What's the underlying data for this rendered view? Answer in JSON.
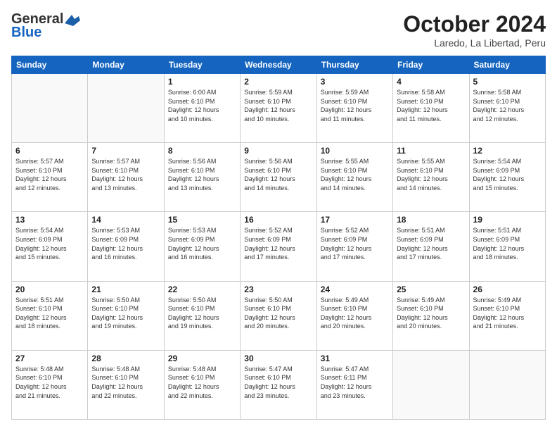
{
  "header": {
    "logo_general": "General",
    "logo_blue": "Blue",
    "month_title": "October 2024",
    "location": "Laredo, La Libertad, Peru"
  },
  "days_of_week": [
    "Sunday",
    "Monday",
    "Tuesday",
    "Wednesday",
    "Thursday",
    "Friday",
    "Saturday"
  ],
  "weeks": [
    [
      {
        "day": "",
        "info": ""
      },
      {
        "day": "",
        "info": ""
      },
      {
        "day": "1",
        "info": "Sunrise: 6:00 AM\nSunset: 6:10 PM\nDaylight: 12 hours\nand 10 minutes."
      },
      {
        "day": "2",
        "info": "Sunrise: 5:59 AM\nSunset: 6:10 PM\nDaylight: 12 hours\nand 10 minutes."
      },
      {
        "day": "3",
        "info": "Sunrise: 5:59 AM\nSunset: 6:10 PM\nDaylight: 12 hours\nand 11 minutes."
      },
      {
        "day": "4",
        "info": "Sunrise: 5:58 AM\nSunset: 6:10 PM\nDaylight: 12 hours\nand 11 minutes."
      },
      {
        "day": "5",
        "info": "Sunrise: 5:58 AM\nSunset: 6:10 PM\nDaylight: 12 hours\nand 12 minutes."
      }
    ],
    [
      {
        "day": "6",
        "info": "Sunrise: 5:57 AM\nSunset: 6:10 PM\nDaylight: 12 hours\nand 12 minutes."
      },
      {
        "day": "7",
        "info": "Sunrise: 5:57 AM\nSunset: 6:10 PM\nDaylight: 12 hours\nand 13 minutes."
      },
      {
        "day": "8",
        "info": "Sunrise: 5:56 AM\nSunset: 6:10 PM\nDaylight: 12 hours\nand 13 minutes."
      },
      {
        "day": "9",
        "info": "Sunrise: 5:56 AM\nSunset: 6:10 PM\nDaylight: 12 hours\nand 14 minutes."
      },
      {
        "day": "10",
        "info": "Sunrise: 5:55 AM\nSunset: 6:10 PM\nDaylight: 12 hours\nand 14 minutes."
      },
      {
        "day": "11",
        "info": "Sunrise: 5:55 AM\nSunset: 6:10 PM\nDaylight: 12 hours\nand 14 minutes."
      },
      {
        "day": "12",
        "info": "Sunrise: 5:54 AM\nSunset: 6:09 PM\nDaylight: 12 hours\nand 15 minutes."
      }
    ],
    [
      {
        "day": "13",
        "info": "Sunrise: 5:54 AM\nSunset: 6:09 PM\nDaylight: 12 hours\nand 15 minutes."
      },
      {
        "day": "14",
        "info": "Sunrise: 5:53 AM\nSunset: 6:09 PM\nDaylight: 12 hours\nand 16 minutes."
      },
      {
        "day": "15",
        "info": "Sunrise: 5:53 AM\nSunset: 6:09 PM\nDaylight: 12 hours\nand 16 minutes."
      },
      {
        "day": "16",
        "info": "Sunrise: 5:52 AM\nSunset: 6:09 PM\nDaylight: 12 hours\nand 17 minutes."
      },
      {
        "day": "17",
        "info": "Sunrise: 5:52 AM\nSunset: 6:09 PM\nDaylight: 12 hours\nand 17 minutes."
      },
      {
        "day": "18",
        "info": "Sunrise: 5:51 AM\nSunset: 6:09 PM\nDaylight: 12 hours\nand 17 minutes."
      },
      {
        "day": "19",
        "info": "Sunrise: 5:51 AM\nSunset: 6:09 PM\nDaylight: 12 hours\nand 18 minutes."
      }
    ],
    [
      {
        "day": "20",
        "info": "Sunrise: 5:51 AM\nSunset: 6:10 PM\nDaylight: 12 hours\nand 18 minutes."
      },
      {
        "day": "21",
        "info": "Sunrise: 5:50 AM\nSunset: 6:10 PM\nDaylight: 12 hours\nand 19 minutes."
      },
      {
        "day": "22",
        "info": "Sunrise: 5:50 AM\nSunset: 6:10 PM\nDaylight: 12 hours\nand 19 minutes."
      },
      {
        "day": "23",
        "info": "Sunrise: 5:50 AM\nSunset: 6:10 PM\nDaylight: 12 hours\nand 20 minutes."
      },
      {
        "day": "24",
        "info": "Sunrise: 5:49 AM\nSunset: 6:10 PM\nDaylight: 12 hours\nand 20 minutes."
      },
      {
        "day": "25",
        "info": "Sunrise: 5:49 AM\nSunset: 6:10 PM\nDaylight: 12 hours\nand 20 minutes."
      },
      {
        "day": "26",
        "info": "Sunrise: 5:49 AM\nSunset: 6:10 PM\nDaylight: 12 hours\nand 21 minutes."
      }
    ],
    [
      {
        "day": "27",
        "info": "Sunrise: 5:48 AM\nSunset: 6:10 PM\nDaylight: 12 hours\nand 21 minutes."
      },
      {
        "day": "28",
        "info": "Sunrise: 5:48 AM\nSunset: 6:10 PM\nDaylight: 12 hours\nand 22 minutes."
      },
      {
        "day": "29",
        "info": "Sunrise: 5:48 AM\nSunset: 6:10 PM\nDaylight: 12 hours\nand 22 minutes."
      },
      {
        "day": "30",
        "info": "Sunrise: 5:47 AM\nSunset: 6:10 PM\nDaylight: 12 hours\nand 23 minutes."
      },
      {
        "day": "31",
        "info": "Sunrise: 5:47 AM\nSunset: 6:11 PM\nDaylight: 12 hours\nand 23 minutes."
      },
      {
        "day": "",
        "info": ""
      },
      {
        "day": "",
        "info": ""
      }
    ]
  ]
}
